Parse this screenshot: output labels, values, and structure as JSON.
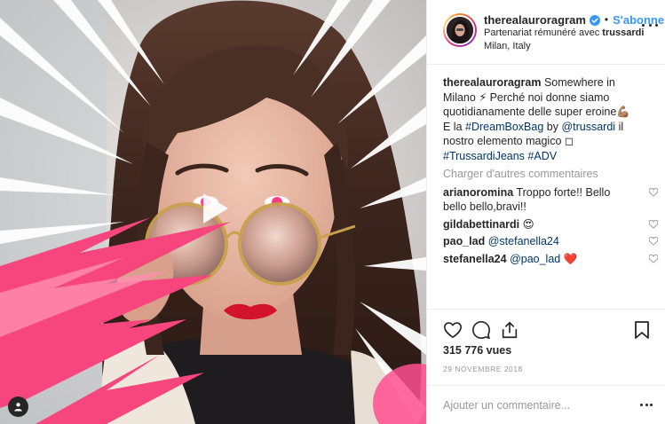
{
  "post": {
    "username": "therealauroragram",
    "separator": "•",
    "follow_label": "S'abonner",
    "partnership_prefix": "Partenariat rémunéré avec",
    "partner": "trussardi",
    "location": "Milan, Italy"
  },
  "caption": {
    "username": "therealauroragram",
    "text_1": "Somewhere in Milano",
    "emoji_1": "⚡",
    "text_2": "Perché noi donne siamo quotidianamente delle super eroine",
    "emoji_2": "💪🏽",
    "text_3": "E la",
    "hashtag_1": "#DreamBoxBag",
    "text_4": "by",
    "mention_1": "@trussardi",
    "text_5": "il nostro elemento magico",
    "emoji_3": "◻",
    "hashtag_2": "#TrussardiJeans",
    "hashtag_3": "#ADV"
  },
  "load_more_label": "Charger d'autres commentaires",
  "comments": [
    {
      "user": "arianoromina",
      "text": "Troppo forte!! Bello bello bello,bravi!!"
    },
    {
      "user": "gildabettinardi",
      "text": "😍"
    },
    {
      "user": "pao_lad",
      "mention": "@stefanella24"
    },
    {
      "user": "stefanella24",
      "mention": "@pao_lad",
      "text": "❤️"
    }
  ],
  "stats": {
    "views": "315 776 vues",
    "date": "29 NOVEMBRE 2018"
  },
  "add_comment": {
    "placeholder": "Ajouter un commentaire..."
  },
  "icons": {
    "like": "heart-icon",
    "comment": "comment-icon",
    "share": "share-icon",
    "save": "bookmark-icon",
    "play": "play-icon",
    "user_tags": "user-tag-icon",
    "verified": "verified-badge-icon"
  },
  "colors": {
    "link": "#003569",
    "follow": "#3897f0",
    "verified": "#3897f0",
    "muted": "#999999",
    "burst_pink": "#f7467e",
    "lips": "#d3132b"
  }
}
